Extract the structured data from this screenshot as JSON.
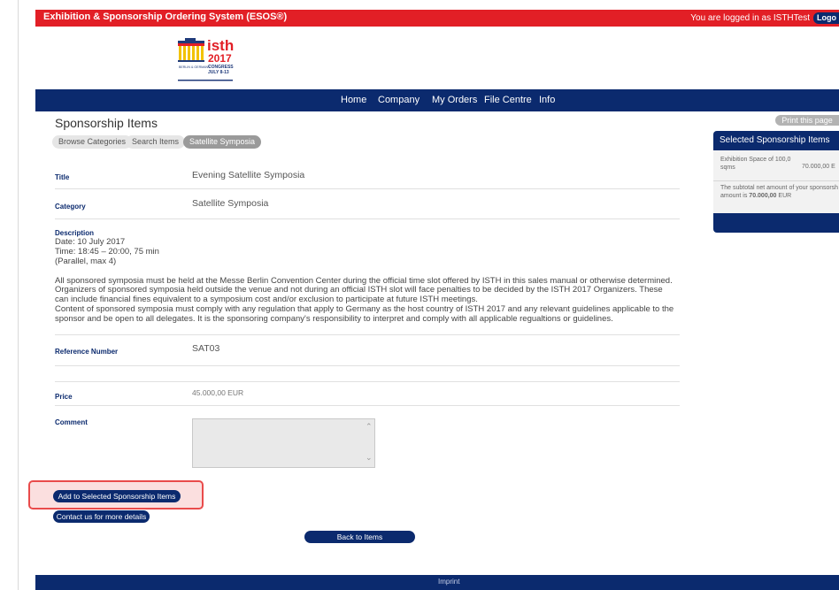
{
  "header": {
    "app_name": "Exhibition & Sponsorship Ordering System (ESOS®)",
    "login_status": "You are logged in as ISTHTest",
    "logout_label": "Logo"
  },
  "logo": {
    "brand": "isth",
    "year": "2017",
    "congress": "CONGRESS",
    "dates": "JULY 8-13",
    "city": "BERLIN & GERMANY"
  },
  "nav": {
    "items": [
      "Home",
      "Company",
      "My Orders",
      "File Centre",
      "Info"
    ]
  },
  "page": {
    "title": "Sponsorship Items",
    "print_label": "Print this page",
    "tabs": [
      "Browse Categories",
      "Search Items",
      "Satellite Symposia"
    ]
  },
  "side_panel": {
    "title": "Selected Sponsorship Items",
    "item_name_1": "Exhibition Space of 100,0",
    "item_name_2": "sqms",
    "item_price": "70.000,00 E",
    "subtotal_line_1": "The subtotal net amount of your sponsorsh",
    "subtotal_line_2_prefix": "amount is ",
    "subtotal_amount": "70.000,00",
    "subtotal_line_2_suffix": " EUR"
  },
  "item": {
    "title_label": "Title",
    "title_value": "Evening Satellite Symposia",
    "category_label": "Category",
    "category_value": "Satellite Symposia",
    "description_label": "Description",
    "description_lines": [
      "Date: 10 July 2017",
      "Time: 18:45 – 20:00, 75 min",
      "(Parallel, max 4)"
    ],
    "body_lines": [
      "All sponsored symposia must be held at the Messe Berlin Convention Center during the official time slot offered by ISTH in this sales manual or otherwise determined.",
      "Organizers of sponsored symposia held outside the venue and not during an official ISTH slot will face penalties to be decided by the ISTH 2017 Organizers. These",
      "can include financial fines equivalent to a symposium cost and/or exclusion to participate at future ISTH meetings.",
      "Content of sponsored symposia must comply with any regulation that apply to Germany as the host country of ISTH 2017 and any relevant guidelines applicable to the",
      "sponsor and be open to all delegates. It is the sponsoring company's responsibility to interpret and comply with all applicable regualtions or guidelines."
    ],
    "reference_label": "Reference Number",
    "reference_value": "SAT03",
    "price_label": "Price",
    "price_value": "45.000,00 EUR",
    "comment_label": "Comment",
    "comment_value": ""
  },
  "actions": {
    "add_label": "Add to Selected Sponsorship Items",
    "contact_label": "Contact us for more details",
    "back_label": "Back to Items"
  },
  "footer": {
    "imprint_label": "Imprint"
  }
}
